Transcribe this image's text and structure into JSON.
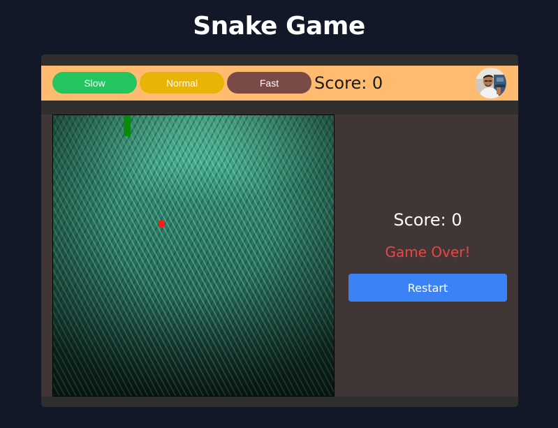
{
  "page": {
    "title": "Snake Game"
  },
  "toolbar": {
    "speed_buttons": [
      {
        "label": "Slow",
        "color": "#22c55e"
      },
      {
        "label": "Normal",
        "color": "#eab308"
      },
      {
        "label": "Fast",
        "color": "#7a4a47"
      }
    ],
    "score_text": "Score: 0",
    "background_color": "#ffbb70",
    "avatar_icon": "user-photo-avatar"
  },
  "game": {
    "score_text": "Score: 0",
    "status_text": "Game Over!",
    "status_color": "#ef4444",
    "restart_label": "Restart",
    "restart_color": "#3b82f6",
    "snake_color": "#0a8a0a",
    "food_color": "#ff1a1a"
  }
}
